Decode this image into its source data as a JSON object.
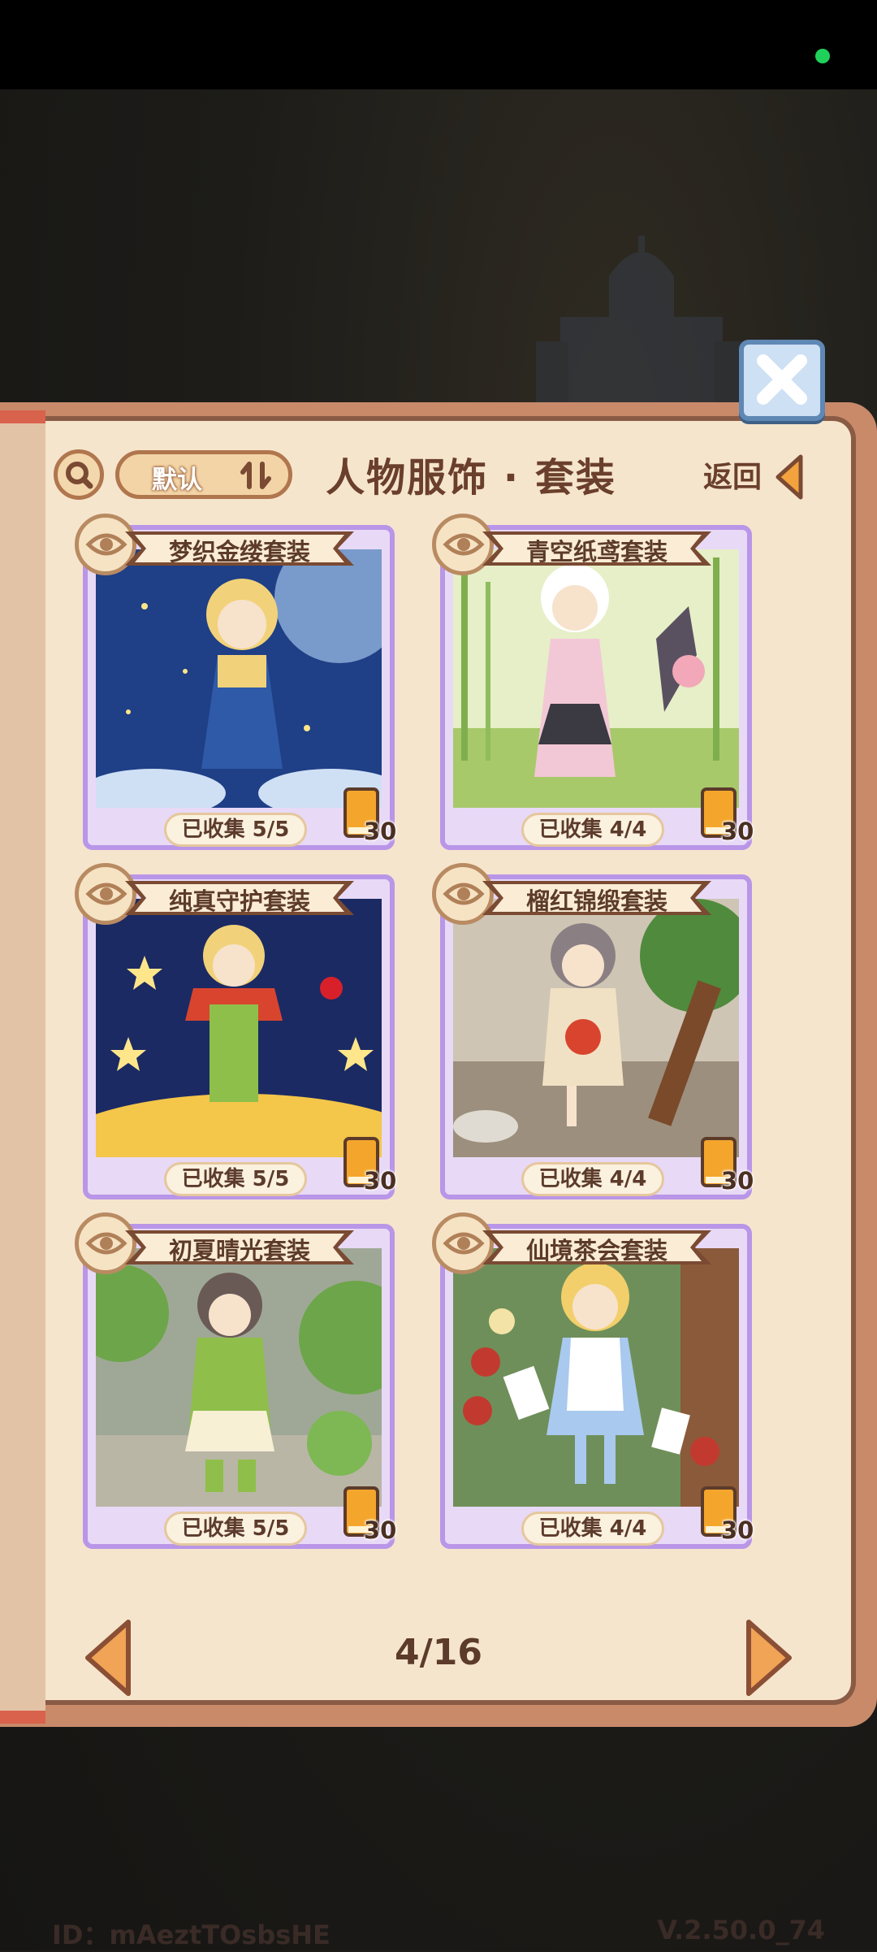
{
  "header": {
    "sort_label": "默认",
    "title": "人物服饰 · 套装",
    "back_label": "返回"
  },
  "cards": [
    {
      "name": "梦织金缕套装",
      "collected": "已收集 5/5",
      "reward": "30"
    },
    {
      "name": "青空纸鸢套装",
      "collected": "已收集 4/4",
      "reward": "30"
    },
    {
      "name": "纯真守护套装",
      "collected": "已收集 5/5",
      "reward": "30"
    },
    {
      "name": "榴红锦缎套装",
      "collected": "已收集 4/4",
      "reward": "30"
    },
    {
      "name": "初夏晴光套装",
      "collected": "已收集 5/5",
      "reward": "30"
    },
    {
      "name": "仙境茶会套装",
      "collected": "已收集 4/4",
      "reward": "30"
    }
  ],
  "pagination": {
    "label": "4/16"
  },
  "footer": {
    "id_text": "ID：mAeztTOsbsHE",
    "version": "V.2.50.0_74"
  }
}
